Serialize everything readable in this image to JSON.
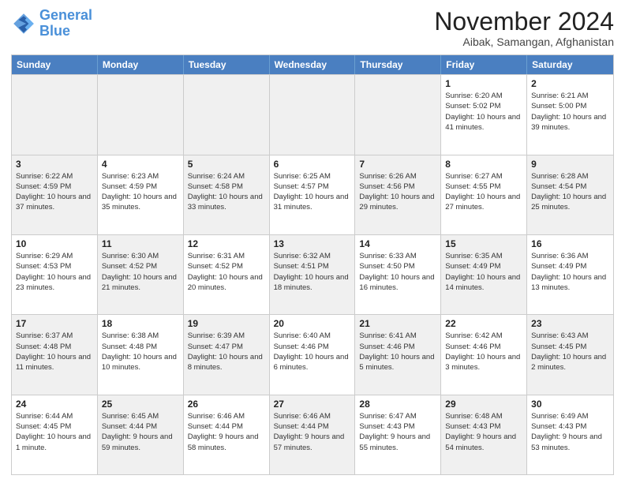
{
  "logo": {
    "line1": "General",
    "line2": "Blue"
  },
  "title": "November 2024",
  "subtitle": "Aibak, Samangan, Afghanistan",
  "days_of_week": [
    "Sunday",
    "Monday",
    "Tuesday",
    "Wednesday",
    "Thursday",
    "Friday",
    "Saturday"
  ],
  "weeks": [
    [
      {
        "day": "",
        "info": "",
        "shaded": true
      },
      {
        "day": "",
        "info": "",
        "shaded": true
      },
      {
        "day": "",
        "info": "",
        "shaded": true
      },
      {
        "day": "",
        "info": "",
        "shaded": true
      },
      {
        "day": "",
        "info": "",
        "shaded": true
      },
      {
        "day": "1",
        "info": "Sunrise: 6:20 AM\nSunset: 5:02 PM\nDaylight: 10 hours and 41 minutes.",
        "shaded": false
      },
      {
        "day": "2",
        "info": "Sunrise: 6:21 AM\nSunset: 5:00 PM\nDaylight: 10 hours and 39 minutes.",
        "shaded": false
      }
    ],
    [
      {
        "day": "3",
        "info": "Sunrise: 6:22 AM\nSunset: 4:59 PM\nDaylight: 10 hours and 37 minutes.",
        "shaded": true
      },
      {
        "day": "4",
        "info": "Sunrise: 6:23 AM\nSunset: 4:59 PM\nDaylight: 10 hours and 35 minutes.",
        "shaded": false
      },
      {
        "day": "5",
        "info": "Sunrise: 6:24 AM\nSunset: 4:58 PM\nDaylight: 10 hours and 33 minutes.",
        "shaded": true
      },
      {
        "day": "6",
        "info": "Sunrise: 6:25 AM\nSunset: 4:57 PM\nDaylight: 10 hours and 31 minutes.",
        "shaded": false
      },
      {
        "day": "7",
        "info": "Sunrise: 6:26 AM\nSunset: 4:56 PM\nDaylight: 10 hours and 29 minutes.",
        "shaded": true
      },
      {
        "day": "8",
        "info": "Sunrise: 6:27 AM\nSunset: 4:55 PM\nDaylight: 10 hours and 27 minutes.",
        "shaded": false
      },
      {
        "day": "9",
        "info": "Sunrise: 6:28 AM\nSunset: 4:54 PM\nDaylight: 10 hours and 25 minutes.",
        "shaded": true
      }
    ],
    [
      {
        "day": "10",
        "info": "Sunrise: 6:29 AM\nSunset: 4:53 PM\nDaylight: 10 hours and 23 minutes.",
        "shaded": false
      },
      {
        "day": "11",
        "info": "Sunrise: 6:30 AM\nSunset: 4:52 PM\nDaylight: 10 hours and 21 minutes.",
        "shaded": true
      },
      {
        "day": "12",
        "info": "Sunrise: 6:31 AM\nSunset: 4:52 PM\nDaylight: 10 hours and 20 minutes.",
        "shaded": false
      },
      {
        "day": "13",
        "info": "Sunrise: 6:32 AM\nSunset: 4:51 PM\nDaylight: 10 hours and 18 minutes.",
        "shaded": true
      },
      {
        "day": "14",
        "info": "Sunrise: 6:33 AM\nSunset: 4:50 PM\nDaylight: 10 hours and 16 minutes.",
        "shaded": false
      },
      {
        "day": "15",
        "info": "Sunrise: 6:35 AM\nSunset: 4:49 PM\nDaylight: 10 hours and 14 minutes.",
        "shaded": true
      },
      {
        "day": "16",
        "info": "Sunrise: 6:36 AM\nSunset: 4:49 PM\nDaylight: 10 hours and 13 minutes.",
        "shaded": false
      }
    ],
    [
      {
        "day": "17",
        "info": "Sunrise: 6:37 AM\nSunset: 4:48 PM\nDaylight: 10 hours and 11 minutes.",
        "shaded": true
      },
      {
        "day": "18",
        "info": "Sunrise: 6:38 AM\nSunset: 4:48 PM\nDaylight: 10 hours and 10 minutes.",
        "shaded": false
      },
      {
        "day": "19",
        "info": "Sunrise: 6:39 AM\nSunset: 4:47 PM\nDaylight: 10 hours and 8 minutes.",
        "shaded": true
      },
      {
        "day": "20",
        "info": "Sunrise: 6:40 AM\nSunset: 4:46 PM\nDaylight: 10 hours and 6 minutes.",
        "shaded": false
      },
      {
        "day": "21",
        "info": "Sunrise: 6:41 AM\nSunset: 4:46 PM\nDaylight: 10 hours and 5 minutes.",
        "shaded": true
      },
      {
        "day": "22",
        "info": "Sunrise: 6:42 AM\nSunset: 4:46 PM\nDaylight: 10 hours and 3 minutes.",
        "shaded": false
      },
      {
        "day": "23",
        "info": "Sunrise: 6:43 AM\nSunset: 4:45 PM\nDaylight: 10 hours and 2 minutes.",
        "shaded": true
      }
    ],
    [
      {
        "day": "24",
        "info": "Sunrise: 6:44 AM\nSunset: 4:45 PM\nDaylight: 10 hours and 1 minute.",
        "shaded": false
      },
      {
        "day": "25",
        "info": "Sunrise: 6:45 AM\nSunset: 4:44 PM\nDaylight: 9 hours and 59 minutes.",
        "shaded": true
      },
      {
        "day": "26",
        "info": "Sunrise: 6:46 AM\nSunset: 4:44 PM\nDaylight: 9 hours and 58 minutes.",
        "shaded": false
      },
      {
        "day": "27",
        "info": "Sunrise: 6:46 AM\nSunset: 4:44 PM\nDaylight: 9 hours and 57 minutes.",
        "shaded": true
      },
      {
        "day": "28",
        "info": "Sunrise: 6:47 AM\nSunset: 4:43 PM\nDaylight: 9 hours and 55 minutes.",
        "shaded": false
      },
      {
        "day": "29",
        "info": "Sunrise: 6:48 AM\nSunset: 4:43 PM\nDaylight: 9 hours and 54 minutes.",
        "shaded": true
      },
      {
        "day": "30",
        "info": "Sunrise: 6:49 AM\nSunset: 4:43 PM\nDaylight: 9 hours and 53 minutes.",
        "shaded": false
      }
    ]
  ]
}
